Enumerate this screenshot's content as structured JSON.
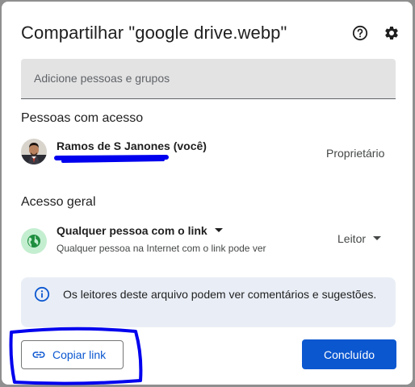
{
  "dialog": {
    "title": "Compartilhar \"google drive.webp\"",
    "icons": [
      "help-icon",
      "settings-icon"
    ]
  },
  "search": {
    "placeholder": "Adicione pessoas e grupos"
  },
  "people": {
    "heading": "Pessoas com acesso",
    "items": [
      {
        "name": "Ramos de S Janones (você)",
        "role": "Proprietário"
      }
    ]
  },
  "general_access": {
    "heading": "Acesso geral",
    "title": "Qualquer pessoa com o link",
    "description": "Qualquer pessoa na Internet com o link pode ver",
    "role": "Leitor"
  },
  "info": {
    "text": "Os leitores deste arquivo podem ver comentários e sugestões."
  },
  "footer": {
    "copy_link": "Copiar link",
    "done": "Concluído"
  },
  "colors": {
    "primary": "#0b57d0",
    "annotation": "#0000ee",
    "globe": "#1e8e3e",
    "info_bg": "#e9eef6"
  }
}
